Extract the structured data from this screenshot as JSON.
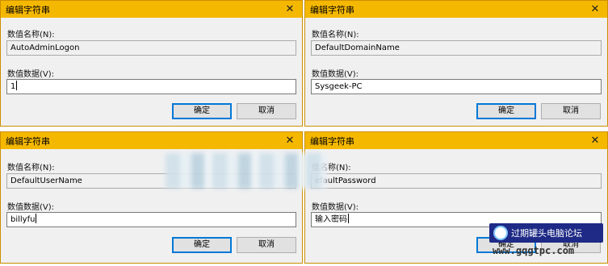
{
  "dialogs": [
    {
      "title": "编辑字符串",
      "name_label": "数值名称(N):",
      "name_value": "AutoAdminLogon",
      "data_label": "数值数据(V):",
      "data_value": "1",
      "ok": "确定",
      "cancel": "取消"
    },
    {
      "title": "编辑字符串",
      "name_label": "数值名称(N):",
      "name_value": "DefaultDomainName",
      "data_label": "数值数据(V):",
      "data_value": "Sysgeek-PC",
      "ok": "确定",
      "cancel": "取消"
    },
    {
      "title": "编辑字符串",
      "name_label": "数值名称(N):",
      "name_value": "DefaultUserName",
      "data_label": "数值数据(V):",
      "data_value": "billyfu",
      "ok": "确定",
      "cancel": "取消"
    },
    {
      "title": "编辑字符串",
      "name_label": "值名称(N):",
      "name_value": "efaultPassword",
      "data_label": "数值数据(V):",
      "data_value": "输入密码",
      "ok": "确定",
      "cancel": "取消"
    }
  ],
  "icons": {
    "close": "close-icon"
  },
  "watermark": {
    "text": "过期罐头电脑论坛",
    "url": "www.gqgtpc.com"
  },
  "colors": {
    "titlebar": "#f5b800",
    "default_button_border": "#0078d7",
    "dialog_bg": "#f0f0f0"
  }
}
